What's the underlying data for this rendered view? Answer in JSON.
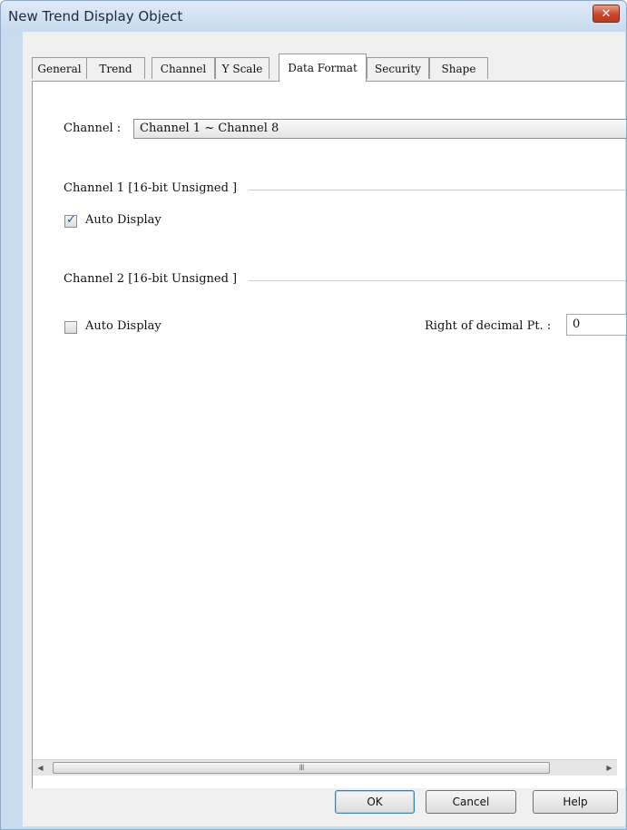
{
  "window": {
    "title": "New Trend Display Object",
    "close_glyph": "✕"
  },
  "tabs": [
    {
      "label": "General"
    },
    {
      "label": "Trend"
    },
    {
      "label": "Channel"
    },
    {
      "label": "Y Scale"
    },
    {
      "label": "Data Format",
      "active": true
    },
    {
      "label": "Security"
    },
    {
      "label": "Shape"
    }
  ],
  "form": {
    "channel_label": "Channel :",
    "channel_value": "Channel 1 ~ Channel 8",
    "group1": {
      "title": "Channel 1 [16-bit Unsigned ]",
      "auto_display_label": "Auto Display",
      "auto_display_checked": true
    },
    "group2": {
      "title": "Channel 2 [16-bit Unsigned ]",
      "auto_display_label": "Auto Display",
      "auto_display_checked": false
    },
    "decimal_label": "Right of decimal Pt. :",
    "decimal_value": "0"
  },
  "scrollbar": {
    "left_arrow": "◀",
    "right_arrow": "▶",
    "grip": "III"
  },
  "buttons": {
    "ok": "OK",
    "cancel": "Cancel",
    "help": "Help"
  },
  "icons": {
    "close": "close-icon",
    "check": "check-icon",
    "scroll_left": "chevron-left-icon",
    "scroll_right": "chevron-right-icon"
  },
  "colors": {
    "frame": "#c9dcef",
    "close_button": "#c8452c",
    "check": "#2a53a5"
  }
}
